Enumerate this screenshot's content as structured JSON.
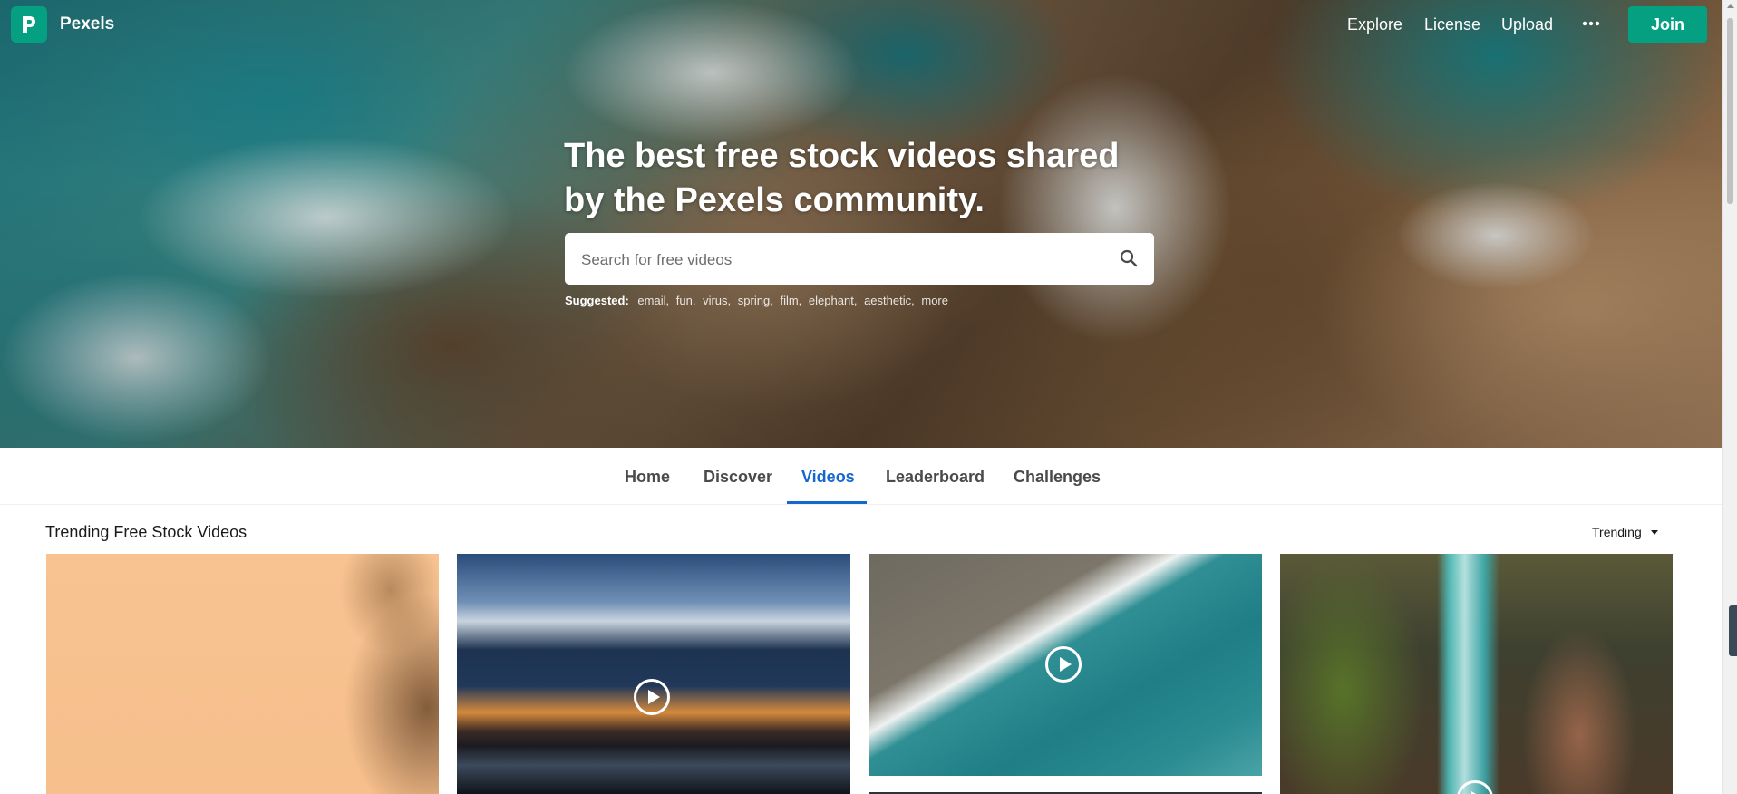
{
  "brand": {
    "name": "Pexels",
    "logo_letter": "P",
    "accent_color": "#05a081"
  },
  "top_nav": {
    "links": [
      {
        "label": "Explore"
      },
      {
        "label": "License"
      },
      {
        "label": "Upload"
      }
    ],
    "more_icon": "more-horizontal-icon",
    "join_label": "Join"
  },
  "hero": {
    "title": "The best free stock videos shared by the Pexels community.",
    "search": {
      "placeholder": "Search for free videos",
      "value": "",
      "icon": "search-icon"
    },
    "suggested": {
      "label": "Suggested:",
      "terms": [
        "email",
        "fun",
        "virus",
        "spring",
        "film",
        "elephant",
        "aesthetic"
      ],
      "more_label": "more"
    }
  },
  "sub_nav": {
    "tabs": [
      {
        "label": "Home"
      },
      {
        "label": "Discover"
      },
      {
        "label": "Videos",
        "active": true
      },
      {
        "label": "Leaderboard"
      },
      {
        "label": "Challenges"
      }
    ],
    "active_color": "#1566cf"
  },
  "section": {
    "title": "Trending Free Stock Videos",
    "sort": {
      "selected": "Trending"
    }
  },
  "videos": [
    {
      "id_label": "video-1",
      "has_play_icon": false
    },
    {
      "id_label": "video-2",
      "has_play_icon": true
    },
    {
      "id_label": "video-3",
      "has_play_icon": true
    },
    {
      "id_label": "video-4",
      "has_play_icon": true
    }
  ]
}
